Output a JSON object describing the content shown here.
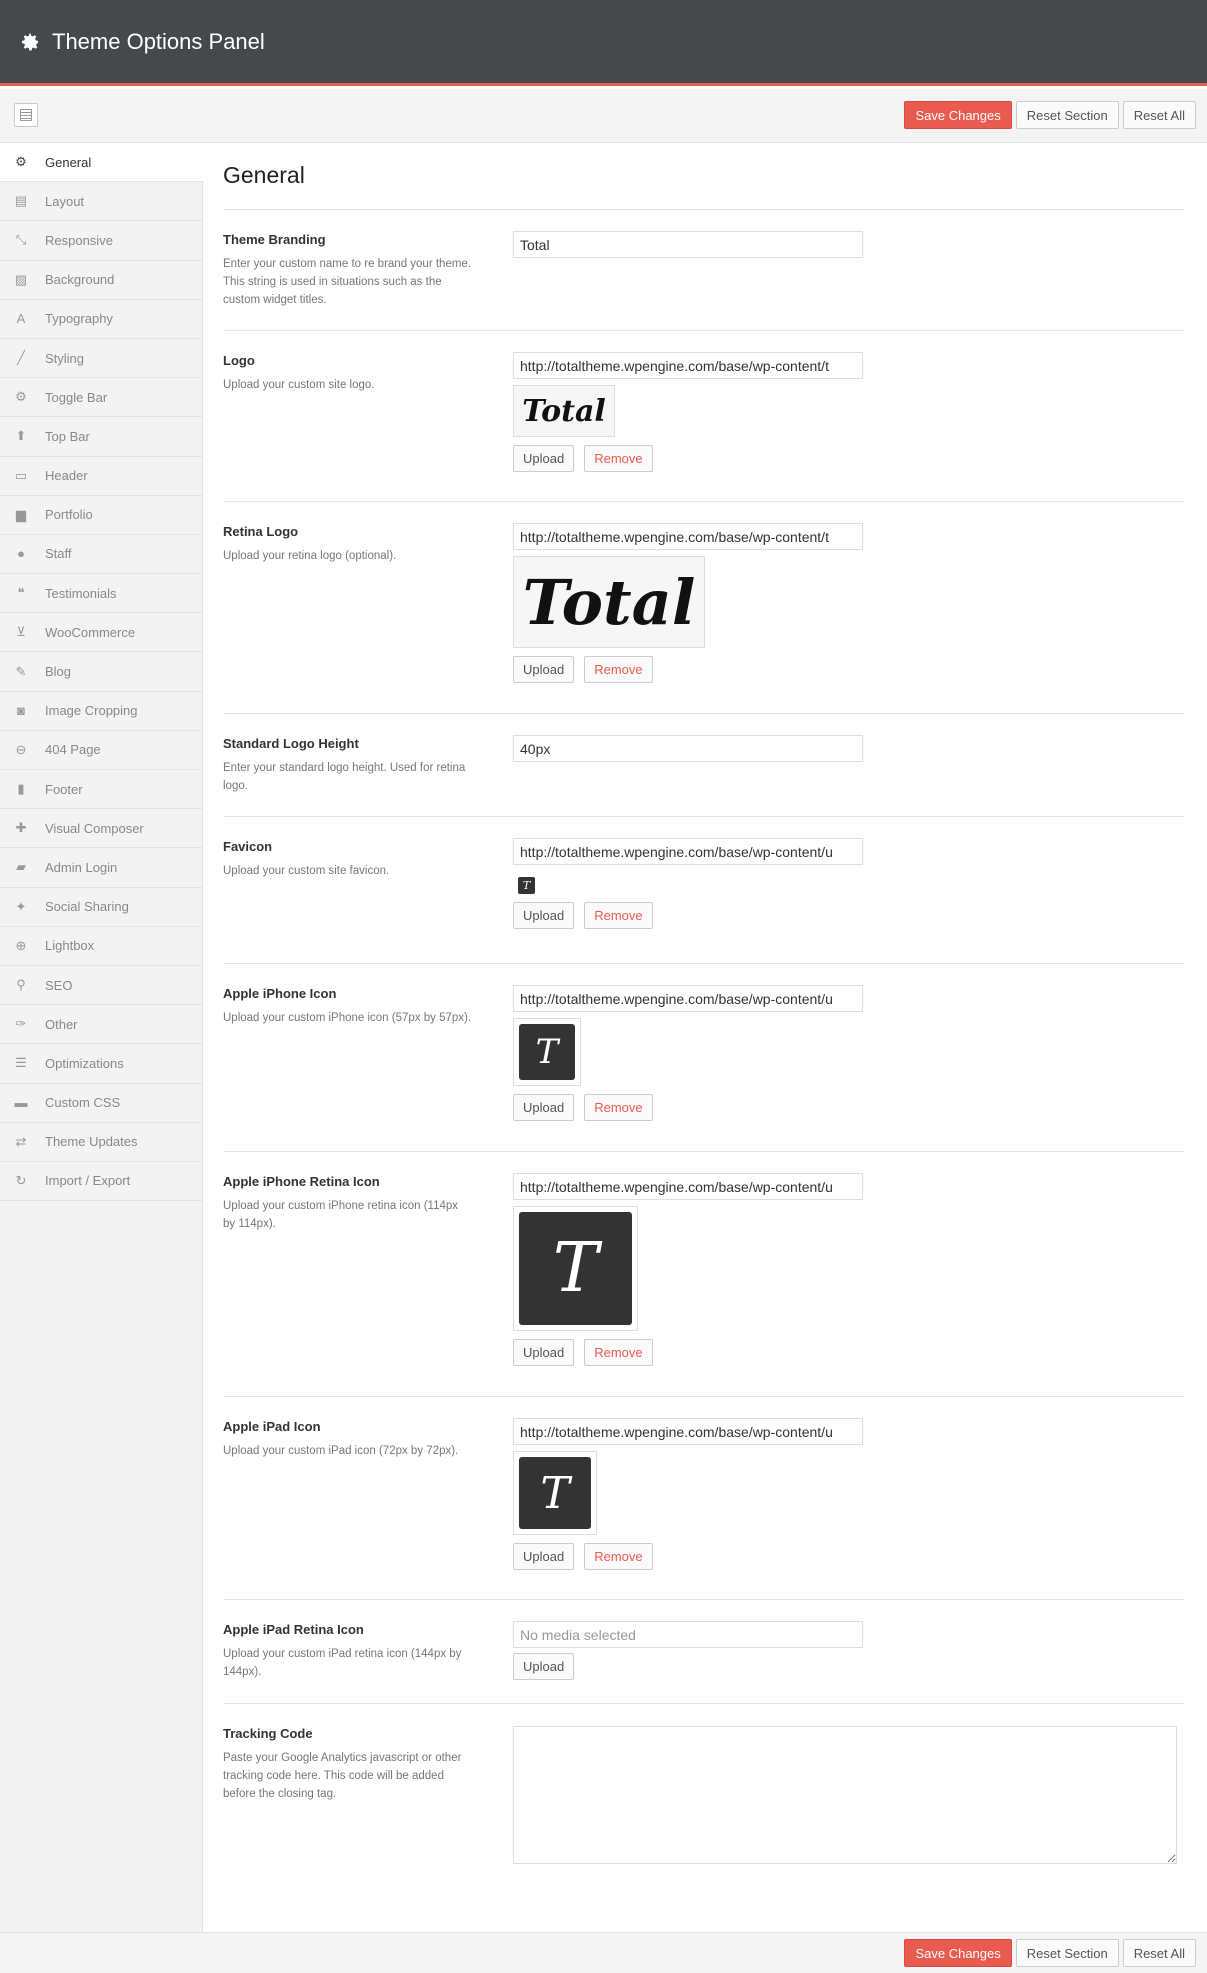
{
  "header": {
    "title": "Theme Options Panel",
    "icon": "gear-icon"
  },
  "toolbar": {
    "save_label": "Save Changes",
    "reset_section_label": "Reset Section",
    "reset_all_label": "Reset All"
  },
  "sidebar": {
    "items": [
      {
        "label": "General",
        "icon": "gear-icon",
        "active": true
      },
      {
        "label": "Layout",
        "icon": "layout-icon"
      },
      {
        "label": "Responsive",
        "icon": "compress-icon"
      },
      {
        "label": "Background",
        "icon": "image-icon"
      },
      {
        "label": "Typography",
        "icon": "font-icon"
      },
      {
        "label": "Styling",
        "icon": "brush-icon"
      },
      {
        "label": "Toggle Bar",
        "icon": "gear-icon"
      },
      {
        "label": "Top Bar",
        "icon": "arrow-up-icon"
      },
      {
        "label": "Header",
        "icon": "monitor-icon"
      },
      {
        "label": "Portfolio",
        "icon": "briefcase-icon"
      },
      {
        "label": "Staff",
        "icon": "user-icon"
      },
      {
        "label": "Testimonials",
        "icon": "quote-icon"
      },
      {
        "label": "WooCommerce",
        "icon": "cart-icon"
      },
      {
        "label": "Blog",
        "icon": "edit-icon"
      },
      {
        "label": "Image Cropping",
        "icon": "camera-icon"
      },
      {
        "label": "404 Page",
        "icon": "minus-circle-icon"
      },
      {
        "label": "Footer",
        "icon": "bookmark-icon"
      },
      {
        "label": "Visual Composer",
        "icon": "puzzle-icon"
      },
      {
        "label": "Admin Login",
        "icon": "lock-icon"
      },
      {
        "label": "Social Sharing",
        "icon": "twitter-icon"
      },
      {
        "label": "Lightbox",
        "icon": "zoom-icon"
      },
      {
        "label": "SEO",
        "icon": "search-icon"
      },
      {
        "label": "Other",
        "icon": "wrench-icon"
      },
      {
        "label": "Optimizations",
        "icon": "list-icon"
      },
      {
        "label": "Custom CSS",
        "icon": "css-icon"
      },
      {
        "label": "Theme Updates",
        "icon": "exchange-icon"
      },
      {
        "label": "Import / Export",
        "icon": "refresh-icon"
      }
    ]
  },
  "main": {
    "title": "General",
    "fields": [
      {
        "title": "Theme Branding",
        "desc": "Enter your custom name to re brand your theme. This string is used in situations such as the custom widget titles.",
        "value": "Total"
      },
      {
        "title": "Logo",
        "desc": "Upload your custom site logo.",
        "value": "http://totaltheme.wpengine.com/base/wp-content/t",
        "preview": "Total"
      },
      {
        "title": "Retina Logo",
        "desc": "Upload your retina logo (optional).",
        "value": "http://totaltheme.wpengine.com/base/wp-content/t",
        "preview": "Total"
      },
      {
        "title": "Standard Logo Height",
        "desc": "Enter your standard logo height. Used for retina logo.",
        "value": "40px"
      },
      {
        "title": "Favicon",
        "desc": "Upload your custom site favicon.",
        "value": "http://totaltheme.wpengine.com/base/wp-content/u"
      },
      {
        "title": "Apple iPhone Icon",
        "desc": "Upload your custom iPhone icon (57px by 57px).",
        "value": "http://totaltheme.wpengine.com/base/wp-content/u"
      },
      {
        "title": "Apple iPhone Retina Icon",
        "desc": "Upload your custom iPhone retina icon (114px by 114px).",
        "value": "http://totaltheme.wpengine.com/base/wp-content/u"
      },
      {
        "title": "Apple iPad Icon",
        "desc": "Upload your custom iPad icon (72px by 72px).",
        "value": "http://totaltheme.wpengine.com/base/wp-content/u"
      },
      {
        "title": "Apple iPad Retina Icon",
        "desc": "Upload your custom iPad retina icon (144px by 144px).",
        "value": "",
        "placeholder": "No media selected"
      },
      {
        "title": "Tracking Code",
        "desc": "Paste your Google Analytics javascript or other tracking code here. This code will be added before the closing tag.",
        "value": ""
      }
    ],
    "upload_label": "Upload",
    "remove_label": "Remove",
    "icon_glyph": "T"
  }
}
